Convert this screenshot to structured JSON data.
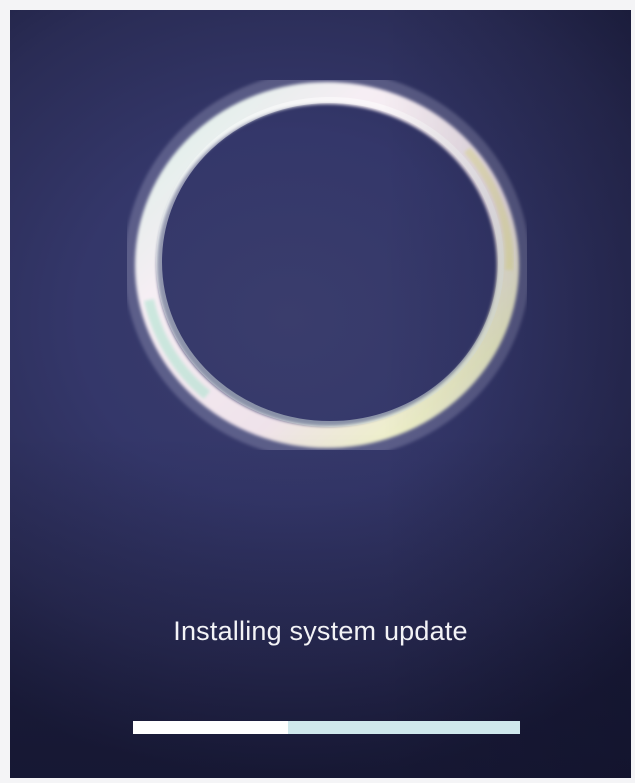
{
  "update": {
    "status_text": "Installing system update",
    "progress_fraction": 0.4,
    "spinner_icon": "circular-progress-ring-icon"
  },
  "colors": {
    "background": "#34376a",
    "ring": "#f3eef2",
    "progress_track": "#cfe8ec",
    "progress_fill": "#ffffff",
    "text": "#f3f3f6"
  }
}
